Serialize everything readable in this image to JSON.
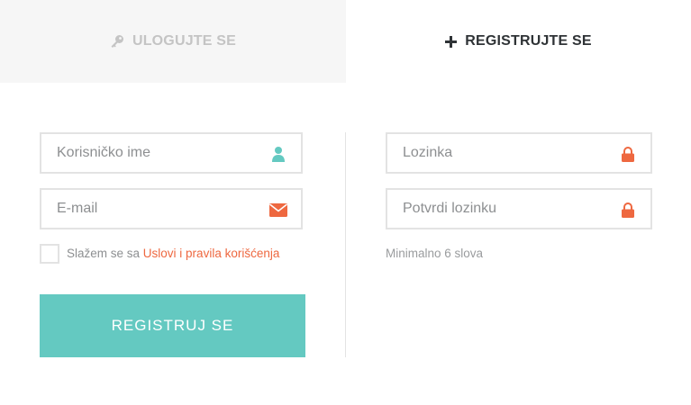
{
  "tabs": {
    "login": {
      "label": "ULOGUJTE SE",
      "icon": "key-icon"
    },
    "register": {
      "label": "REGISTRUJTE SE",
      "icon": "plus-icon"
    }
  },
  "form": {
    "username": {
      "placeholder": "Korisničko ime",
      "value": "",
      "icon": "user-icon"
    },
    "email": {
      "placeholder": "E-mail",
      "value": "",
      "icon": "envelope-icon"
    },
    "password": {
      "placeholder": "Lozinka",
      "value": "",
      "icon": "lock-icon"
    },
    "confirm_password": {
      "placeholder": "Potvrdi lozinku",
      "value": "",
      "icon": "lock-icon"
    },
    "terms": {
      "prefix": "Slažem se sa ",
      "link": "Uslovi i pravila korišćenja",
      "checked": false
    },
    "password_hint": "Minimalno 6 slova",
    "submit_label": "REGISTRUJ SE"
  },
  "colors": {
    "accent_teal": "#64c9c1",
    "accent_orange": "#ee6840",
    "border": "#e3e3e3",
    "inactive_tab_bg": "#f6f6f6"
  }
}
